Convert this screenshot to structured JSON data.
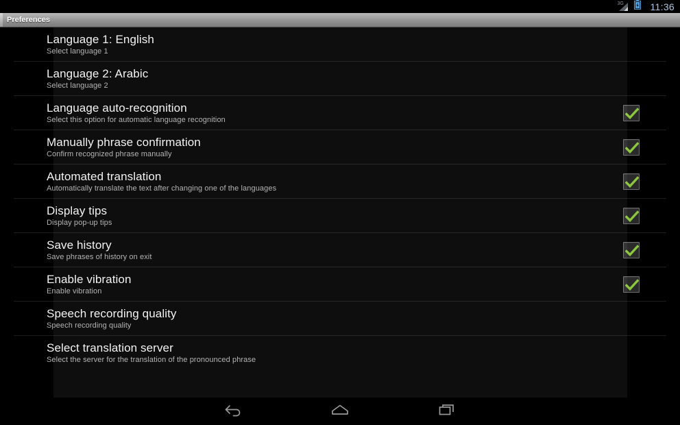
{
  "status_bar": {
    "network_label": "3G",
    "signal_icon": "signal-bars-icon",
    "battery_icon": "battery-icon",
    "time": "11:36"
  },
  "title_bar": {
    "title": "Preferences"
  },
  "colors": {
    "accent_check": "#8cc63e",
    "title_text": "#ffffff",
    "summary_text": "#b0b0b0",
    "clock_text": "#a8c8e8",
    "background": "#000000",
    "overlay": "#1e1e1e"
  },
  "preferences": {
    "rows": [
      {
        "title": "Language 1: English",
        "summary": "Select language 1",
        "widget": "none",
        "checked": false
      },
      {
        "title": "Language 2: Arabic",
        "summary": "Select language 2",
        "widget": "none",
        "checked": false
      },
      {
        "title": "Language auto-recognition",
        "summary": "Select this option for automatic language recognition",
        "widget": "checkbox",
        "checked": true
      },
      {
        "title": "Manually phrase confirmation",
        "summary": "Confirm recognized phrase manually",
        "widget": "checkbox",
        "checked": true
      },
      {
        "title": "Automated translation",
        "summary": "Automatically translate the text after changing one of the languages",
        "widget": "checkbox",
        "checked": true
      },
      {
        "title": "Display tips",
        "summary": "Display pop-up tips",
        "widget": "checkbox",
        "checked": true
      },
      {
        "title": "Save history",
        "summary": "Save phrases of history on exit",
        "widget": "checkbox",
        "checked": true
      },
      {
        "title": "Enable vibration",
        "summary": "Enable vibration",
        "widget": "checkbox",
        "checked": true
      },
      {
        "title": "Speech recording quality",
        "summary": "Speech recording quality",
        "widget": "none",
        "checked": false
      },
      {
        "title": "Select translation server",
        "summary": "Select the server for the translation of the pronounced phrase",
        "widget": "none",
        "checked": false
      }
    ]
  },
  "nav_bar": {
    "back": "back-icon",
    "home": "home-icon",
    "recents": "recents-icon"
  }
}
